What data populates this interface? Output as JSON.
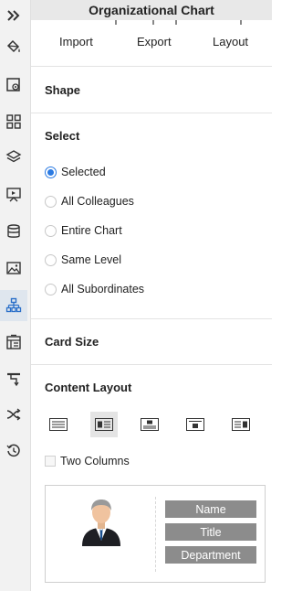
{
  "panel": {
    "title": "Organizational Chart",
    "toolbar": {
      "import_label": "Import",
      "export_label": "Export",
      "layout_label": "Layout"
    }
  },
  "sections": {
    "shape": {
      "title": "Shape"
    },
    "select": {
      "title": "Select",
      "options": [
        {
          "label": "Selected",
          "checked": true
        },
        {
          "label": "All Colleagues",
          "checked": false
        },
        {
          "label": "Entire Chart",
          "checked": false
        },
        {
          "label": "Same Level",
          "checked": false
        },
        {
          "label": "All Subordinates",
          "checked": false
        }
      ]
    },
    "card_size": {
      "title": "Card Size"
    },
    "content_layout": {
      "title": "Content Layout",
      "selected_index": 1,
      "two_columns": {
        "label": "Two Columns",
        "checked": false
      },
      "preview_fields": [
        "Name",
        "Title",
        "Department"
      ]
    }
  },
  "rail": {
    "items": [
      {
        "icon": "chevrons-right-icon",
        "active": false
      },
      {
        "icon": "paint-bucket-icon",
        "active": false
      },
      {
        "icon": "page-setup-icon",
        "active": false
      },
      {
        "icon": "symbol-grid-icon",
        "active": false
      },
      {
        "icon": "layers-icon",
        "active": false
      },
      {
        "icon": "presentation-icon",
        "active": false
      },
      {
        "icon": "database-icon",
        "active": false
      },
      {
        "icon": "image-icon",
        "active": false
      },
      {
        "icon": "org-chart-icon",
        "active": true
      },
      {
        "icon": "layout-icon",
        "active": false
      },
      {
        "icon": "connector-icon",
        "active": false
      },
      {
        "icon": "shuffle-icon",
        "active": false
      },
      {
        "icon": "history-icon",
        "active": false
      }
    ]
  },
  "colors": {
    "accent": "#2a7ae2",
    "icon": "#333333",
    "active_icon": "#2a6fc9",
    "field_pill": "#8c8c8c"
  }
}
